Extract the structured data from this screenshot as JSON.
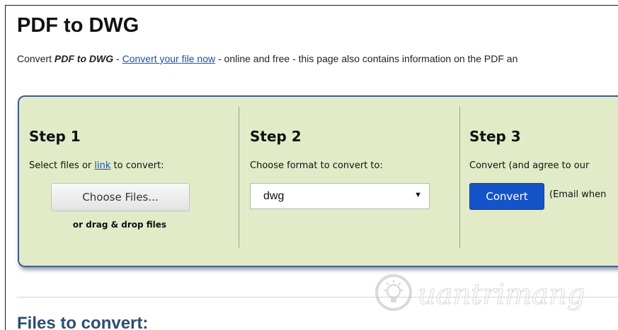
{
  "page": {
    "title": "PDF to DWG",
    "intro": {
      "prefix": "Convert ",
      "emphasis": "PDF to DWG",
      "dash": " - ",
      "link": "Convert your file now",
      "suffix": " - online and free - this page also contains information on the PDF an"
    }
  },
  "steps": {
    "step1": {
      "title": "Step 1",
      "desc_before": "Select files or ",
      "desc_link": "link",
      "desc_after": " to convert:",
      "button": "Choose Files...",
      "note": "or drag & drop files"
    },
    "step2": {
      "title": "Step 2",
      "desc": "Choose format to convert to:",
      "selected": "dwg",
      "arrow": "▼"
    },
    "step3": {
      "title": "Step 3",
      "desc": "Convert (and agree to our",
      "button": "Convert",
      "note": "(Email when"
    }
  },
  "section": {
    "title": "Files to convert:"
  },
  "watermark": {
    "text": "uantrimang"
  },
  "colors": {
    "panel_bg": "#e1ebc8",
    "panel_border": "#3f5e86",
    "link": "#1a4fb0",
    "convert_button": "#1453c8",
    "section_title": "#2d4d72"
  }
}
